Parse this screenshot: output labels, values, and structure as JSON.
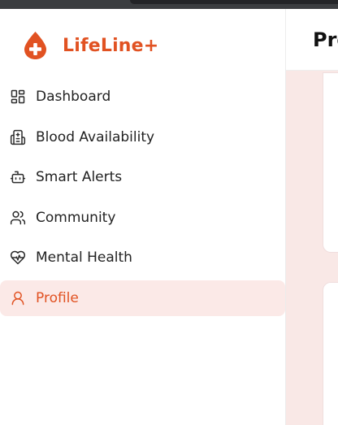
{
  "brand": {
    "name": "LifeLine+",
    "logo_icon": "blood-drop-plus-icon",
    "color": "#e15222"
  },
  "nav": {
    "items": [
      {
        "label": "Dashboard",
        "icon": "dashboard-grid-icon",
        "active": false
      },
      {
        "label": "Blood Availability",
        "icon": "hospital-icon",
        "active": false
      },
      {
        "label": "Smart Alerts",
        "icon": "bot-icon",
        "active": false
      },
      {
        "label": "Community",
        "icon": "users-icon",
        "active": false
      },
      {
        "label": "Mental Health",
        "icon": "heart-pulse-icon",
        "active": false
      },
      {
        "label": "Profile",
        "icon": "user-icon",
        "active": true
      }
    ]
  },
  "main": {
    "heading": "Pro"
  },
  "colors": {
    "accent": "#e15222",
    "active_bg": "#fbe9e7",
    "content_bg": "#f9e8e6"
  }
}
